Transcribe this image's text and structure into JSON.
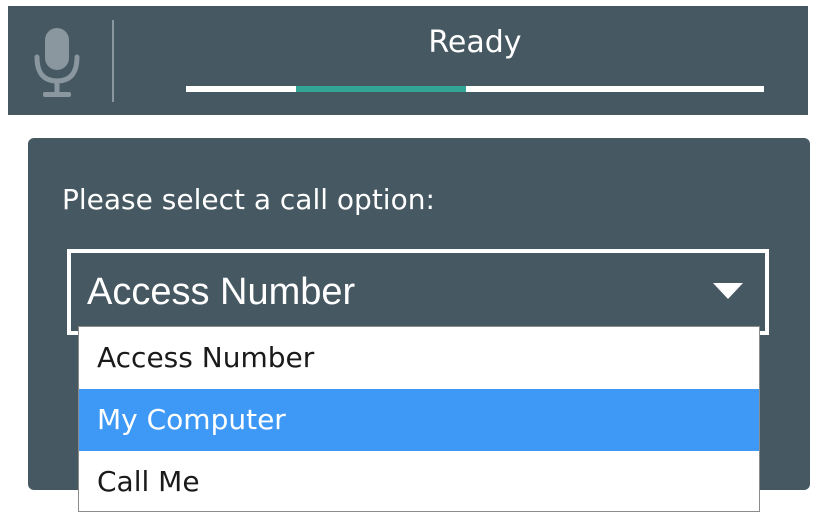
{
  "status_bar": {
    "mic_icon": "microphone-icon",
    "status": "Ready",
    "progress": {
      "segment_start": 0.19,
      "segment_end": 0.485
    },
    "colors": {
      "background": "#465862",
      "accent": "#33a596"
    }
  },
  "call_panel": {
    "prompt": "Please select a call option:",
    "select": {
      "selected_value": "Access Number",
      "caret_icon": "caret-down-icon"
    },
    "options": [
      {
        "label": "Access Number",
        "highlighted": false
      },
      {
        "label": "My Computer",
        "highlighted": true
      },
      {
        "label": "Call Me",
        "highlighted": false
      }
    ],
    "colors": {
      "highlight": "#3d99f5"
    }
  }
}
